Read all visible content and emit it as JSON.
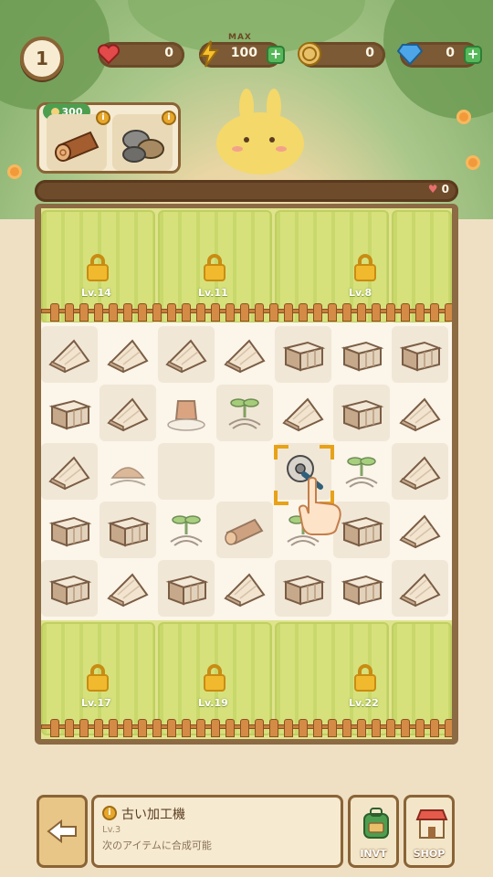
{
  "hud": {
    "player_level": "1",
    "hearts": {
      "value": "0",
      "icon": "heart-icon"
    },
    "energy": {
      "label": "MAX",
      "value": "100",
      "icon": "lightning-icon"
    },
    "coins": {
      "value": "0",
      "icon": "coin-icon"
    },
    "gems": {
      "value": "0",
      "icon": "gem-icon"
    }
  },
  "order": {
    "reward": "300",
    "items": [
      {
        "name": "log",
        "icon": "log-icon"
      },
      {
        "name": "stones",
        "icon": "stones-icon"
      }
    ]
  },
  "progress": {
    "count": "0"
  },
  "locked_areas": {
    "top": [
      "Lv.14",
      "Lv.11",
      "Lv.8"
    ],
    "bottom": [
      "Lv.17",
      "Lv.19",
      "Lv.22"
    ]
  },
  "board": {
    "rows": [
      [
        "wedge",
        "wedge",
        "wedge",
        "wedge",
        "box",
        "box",
        "box"
      ],
      [
        "box",
        "wedge",
        "stump",
        "sprout-roots",
        "wedge",
        "box",
        "wedge"
      ],
      [
        "wedge",
        "dirt-pile",
        "empty",
        "empty",
        "saw-machine",
        "sprout-roots",
        "wedge"
      ],
      [
        "box",
        "box",
        "sprout-roots",
        "logs",
        "sprout-roots",
        "box",
        "wedge"
      ],
      [
        "box",
        "wedge",
        "box",
        "wedge",
        "box",
        "box",
        "wedge"
      ]
    ]
  },
  "info": {
    "title": "古い加工機",
    "level": "Lv.3",
    "description": "次のアイテムに合成可能"
  },
  "buttons": {
    "inventory": "INVT",
    "shop": "SHOP"
  },
  "colors": {
    "accent": "#e8a218",
    "frame": "#8a6436",
    "grass": "#dfe48c"
  }
}
